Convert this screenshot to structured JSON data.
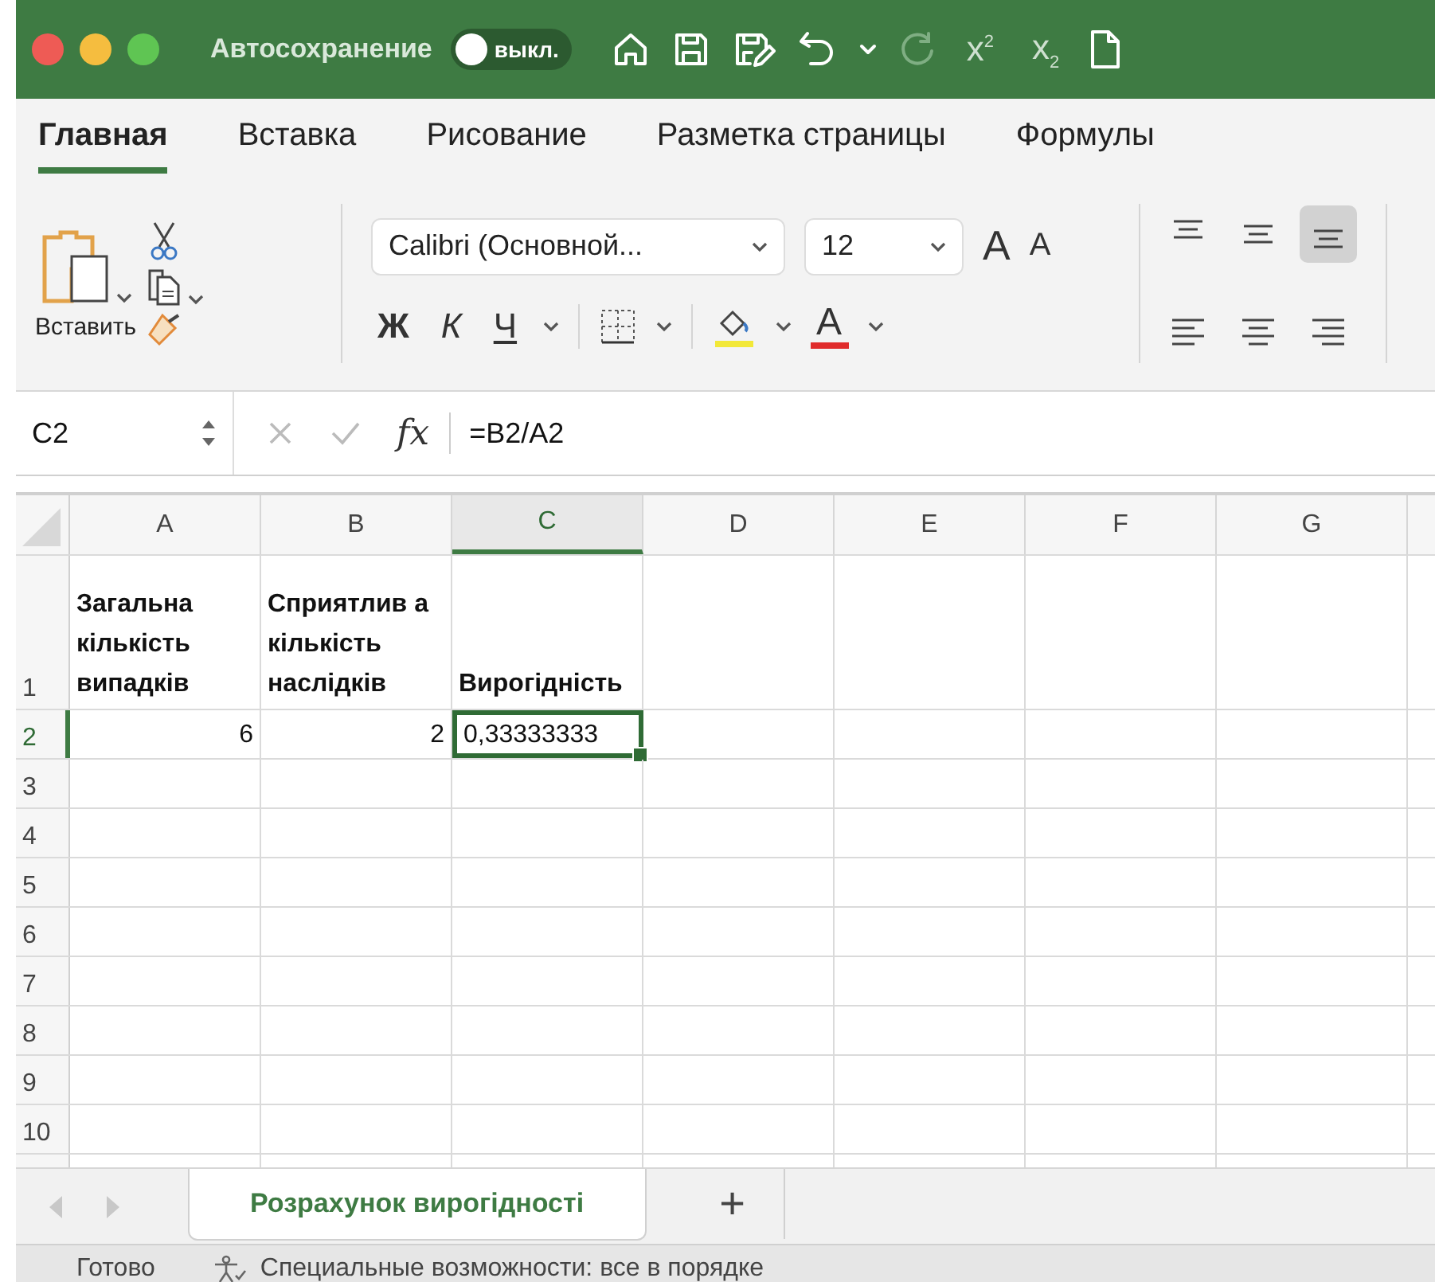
{
  "window": {
    "autosave_label": "Автосохранение",
    "autosave_toggle": {
      "on": false,
      "label": "выкл."
    },
    "superscript": "x$^{2}$",
    "subscript": "x$_{2}$"
  },
  "ribbon_tabs": [
    {
      "label": "Главная",
      "selected": true
    },
    {
      "label": "Вставка",
      "selected": false
    },
    {
      "label": "Рисование",
      "selected": false
    },
    {
      "label": "Разметка страницы",
      "selected": false
    },
    {
      "label": "Формулы",
      "selected": false
    }
  ],
  "ribbon": {
    "paste_label": "Вставить",
    "font_name": "Calibri (Основной...",
    "font_size": "12",
    "grow_font": "A",
    "shrink_font": "A",
    "bold": "Ж",
    "italic": "К",
    "underline": "Ч",
    "font_color": "A",
    "alignment": [
      {
        "kind": "top",
        "selected": false
      },
      {
        "kind": "middle",
        "selected": false
      },
      {
        "kind": "bottom",
        "selected": true
      },
      {
        "kind": "left",
        "selected": false
      },
      {
        "kind": "center",
        "selected": false
      },
      {
        "kind": "right",
        "selected": false
      }
    ]
  },
  "formula_bar": {
    "cell_ref": "C2",
    "fx": "fx",
    "formula": "=B2/A2"
  },
  "columns": [
    {
      "label": "A",
      "selected": false
    },
    {
      "label": "B",
      "selected": false
    },
    {
      "label": "C",
      "selected": true
    },
    {
      "label": "D",
      "selected": false
    },
    {
      "label": "E",
      "selected": false
    },
    {
      "label": "F",
      "selected": false
    },
    {
      "label": "G",
      "selected": false
    }
  ],
  "rows": [
    {
      "number": "1",
      "selected": false,
      "cells": [
        {
          "kind": "text",
          "value": "Загальна кількість випадків"
        },
        {
          "kind": "text",
          "value": "Сприятлив а кількість наслідків"
        },
        {
          "kind": "text",
          "value": "Вирогідність"
        }
      ]
    },
    {
      "number": "2",
      "selected": true,
      "cells": [
        {
          "kind": "number",
          "value": "6"
        },
        {
          "kind": "number",
          "value": "2"
        },
        {
          "kind": "number",
          "value": "0,33333333",
          "selected": true
        }
      ]
    },
    {
      "number": "3",
      "selected": false,
      "cells": []
    },
    {
      "number": "4",
      "selected": false,
      "cells": []
    },
    {
      "number": "5",
      "selected": false,
      "cells": []
    },
    {
      "number": "6",
      "selected": false,
      "cells": []
    },
    {
      "number": "7",
      "selected": false,
      "cells": []
    },
    {
      "number": "8",
      "selected": false,
      "cells": []
    },
    {
      "number": "9",
      "selected": false,
      "cells": []
    },
    {
      "number": "10",
      "selected": false,
      "cells": []
    }
  ],
  "sheet_tabs": [
    {
      "label": "Розрахунок вирогідності",
      "selected": true
    }
  ],
  "add_sheet": "+",
  "status_bar": {
    "ready": "Готово",
    "accessibility": "Специальные возможности: все в порядке"
  }
}
